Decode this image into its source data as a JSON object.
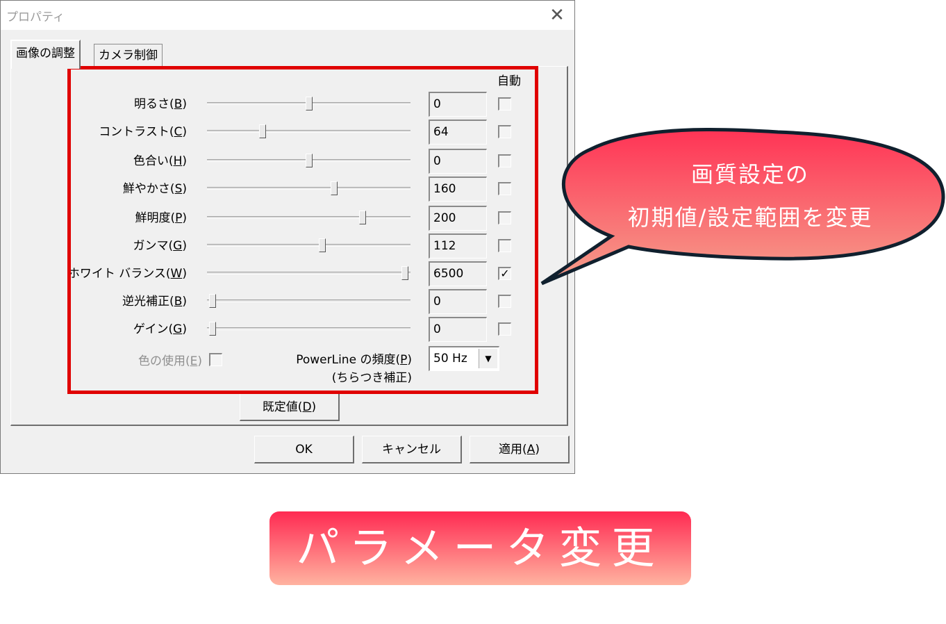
{
  "dialog": {
    "title": "プロパティ",
    "close_glyph": "✕",
    "tabs": [
      {
        "label": "画像の調整"
      },
      {
        "label": "カメラ制御"
      }
    ],
    "auto_header": "自動",
    "rows": [
      {
        "label": "明るさ(",
        "key": "B",
        "value": "0",
        "slider_fraction": 0.5,
        "auto": false
      },
      {
        "label": "コントラスト(",
        "key": "C",
        "value": "64",
        "slider_fraction": 0.26,
        "auto": false
      },
      {
        "label": "色合い(",
        "key": "H",
        "value": "0",
        "slider_fraction": 0.5,
        "auto": false
      },
      {
        "label": "鮮やかさ(",
        "key": "S",
        "value": "160",
        "slider_fraction": 0.63,
        "auto": false
      },
      {
        "label": "鮮明度(",
        "key": "P",
        "value": "200",
        "slider_fraction": 0.78,
        "auto": false
      },
      {
        "label": "ガンマ(",
        "key": "G",
        "value": "112",
        "slider_fraction": 0.57,
        "auto": false
      },
      {
        "label": "ホワイト バランス(",
        "key": "W",
        "value": "6500",
        "slider_fraction": 1.0,
        "auto": true
      },
      {
        "label": "逆光補正(",
        "key": "B",
        "value": "0",
        "slider_fraction": 0.0,
        "auto": false
      },
      {
        "label": "ゲイン(",
        "key": "G",
        "value": "0",
        "slider_fraction": 0.0,
        "auto": false
      }
    ],
    "color_use": {
      "label": "色の使用(",
      "key": "E",
      "checked": false
    },
    "powerline": {
      "label": "PowerLine の頻度(",
      "key": "P",
      "sub_label": "(ちらつき補正)",
      "value": "50 Hz"
    },
    "default_button": {
      "label": "既定値(",
      "key": "D"
    },
    "ok_button": "OK",
    "cancel_button": "キャンセル",
    "apply_button": {
      "label": "適用(",
      "key": "A"
    },
    "close_paren": ")",
    "checkmark": "✓"
  },
  "callout": {
    "line1": "画質設定の",
    "line2": "初期値/設定範囲を変更",
    "fill_top": "#ff3355",
    "fill_bottom": "#f5a08c",
    "stroke": "#10202e"
  },
  "banner": {
    "text": "パラメータ変更",
    "color_top": "#ff2a52",
    "color_bottom": "#ffb3a0"
  },
  "annotation_frame_color": "#e00000"
}
